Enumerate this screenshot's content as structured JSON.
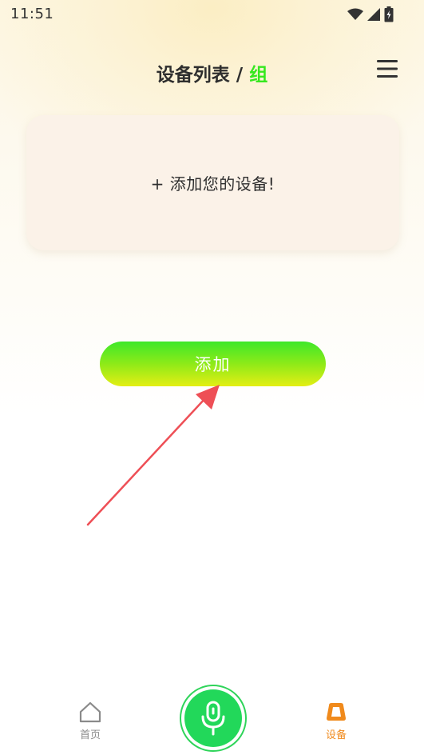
{
  "status_bar": {
    "time": "11:51",
    "icons": [
      "wifi-icon",
      "signal-icon",
      "battery-icon"
    ]
  },
  "header": {
    "title": "设备列表",
    "separator": "/",
    "group_label": "组",
    "menu_icon": "hamburger-menu-icon"
  },
  "device_card": {
    "text": "+ 添加您的设备!"
  },
  "add_button": {
    "label": "添加"
  },
  "tabbar": {
    "home_label": "首页",
    "device_label": "设备",
    "mic_icon": "microphone-icon",
    "active_tab": "设备"
  },
  "colors": {
    "group_accent": "#35e81f",
    "active_tab": "#f08a1c",
    "mic_button": "#22d85a",
    "annotation_arrow": "#ee4f56"
  }
}
